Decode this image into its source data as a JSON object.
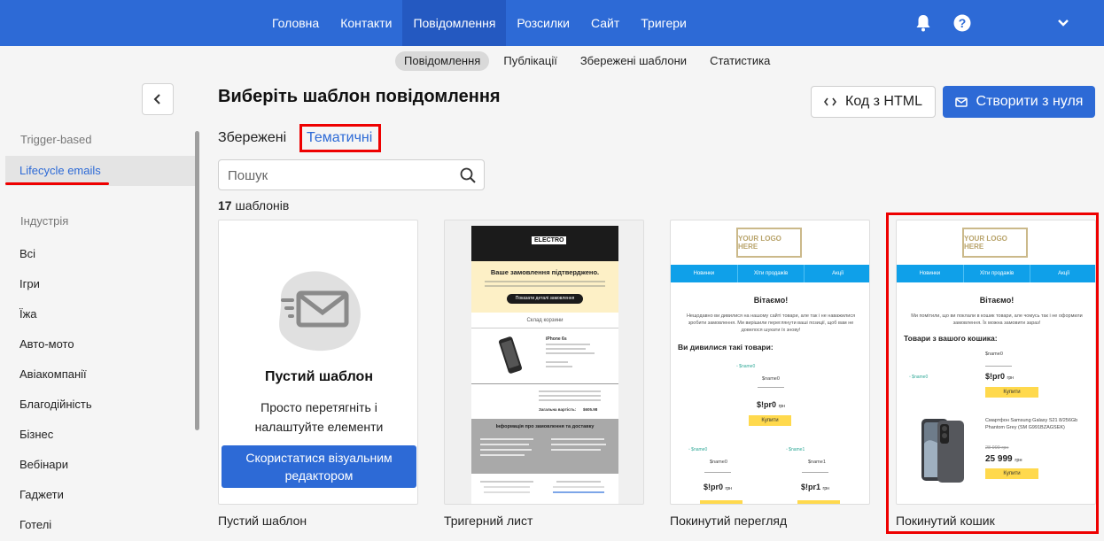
{
  "topnav": {
    "items": [
      "Головна",
      "Контакти",
      "Повідомлення",
      "Розсилки",
      "Сайт",
      "Тригери"
    ],
    "active_index": 2
  },
  "subnav": {
    "items": [
      "Повідомлення",
      "Публікації",
      "Збережені шаблони",
      "Статистика"
    ],
    "active_index": 0
  },
  "sidebar": {
    "section1": "Trigger-based",
    "active_item": "Lifecycle emails",
    "section2": "Індустрія",
    "items": [
      "Всі",
      "Ігри",
      "Їжа",
      "Авто-мото",
      "Авіакомпанії",
      "Благодійність",
      "Бізнес",
      "Вебінари",
      "Гаджети",
      "Готелі"
    ]
  },
  "main": {
    "title": "Виберіть шаблон повідомлення",
    "html_button": "Код з HTML",
    "create_button": "Створити з нуля",
    "tabs": {
      "saved": "Збережені",
      "thematic": "Тематичні"
    },
    "search_placeholder": "Пошук",
    "count_number": "17",
    "count_label": "шаблонів"
  },
  "cards": {
    "blank": {
      "title": "Пустий шаблон",
      "description": "Просто перетягніть і налаштуйте елементи",
      "button": "Скористатися візуальним редактором",
      "name": "Пустий шаблон"
    },
    "trigger": {
      "name": "Тригерний лист",
      "logo": "ELECTRO",
      "heading": "Ваше замовлення підтверджено.",
      "button": "Показати деталі замовлення",
      "cart": "Склад корзини",
      "product": "iPhone 6s",
      "total": "$605.98",
      "info": "Інформація про замовлення та доставку"
    },
    "browse": {
      "name": "Покинутий перегляд",
      "logo": "YOUR LOGO HERE",
      "nav": [
        "Новинки",
        "Хіти продажів",
        "Акції"
      ],
      "greeting": "Вітаємо!",
      "text": "Нещодавно ви дивилися на нашому сайті товари, але так і не наважилися зробити замовлення. Ми вирішили переглянути ваші позиції, щоб вам не довелося шукати їх знову!",
      "subheading": "Ви дивилися такі товари:",
      "item_name": "$name0",
      "price": "$!pr0",
      "currency": "грн",
      "buy": "Купити",
      "item2": "$name1",
      "price2": "$!pr1"
    },
    "cart": {
      "name": "Покинутий кошик",
      "logo": "YOUR LOGO HERE",
      "nav": [
        "Новинки",
        "Хіти продажів",
        "Акції"
      ],
      "greeting": "Вітаємо!",
      "text": "Ми помітили, що ви поклали в кошик товари, але чомусь так і не оформили замовлення. Їх можна замовити зараз!",
      "subheading": "Товари з вашого кошика:",
      "item_name": "$name0",
      "price": "$!pr0",
      "currency": "грн",
      "buy": "Купити",
      "product2": "Смартфон Samsung Galaxy S21 8/256Gb Phantom Grey (SM G991BZAGSEK)",
      "old_price2": "28 999 грн",
      "price2": "25 999",
      "buy2": "Купити"
    }
  },
  "colors": {
    "primary": "#2d6ad6",
    "highlight": "#ee0000",
    "accent_blue": "#0fa0e9",
    "buy_yellow": "#ffd94d"
  }
}
